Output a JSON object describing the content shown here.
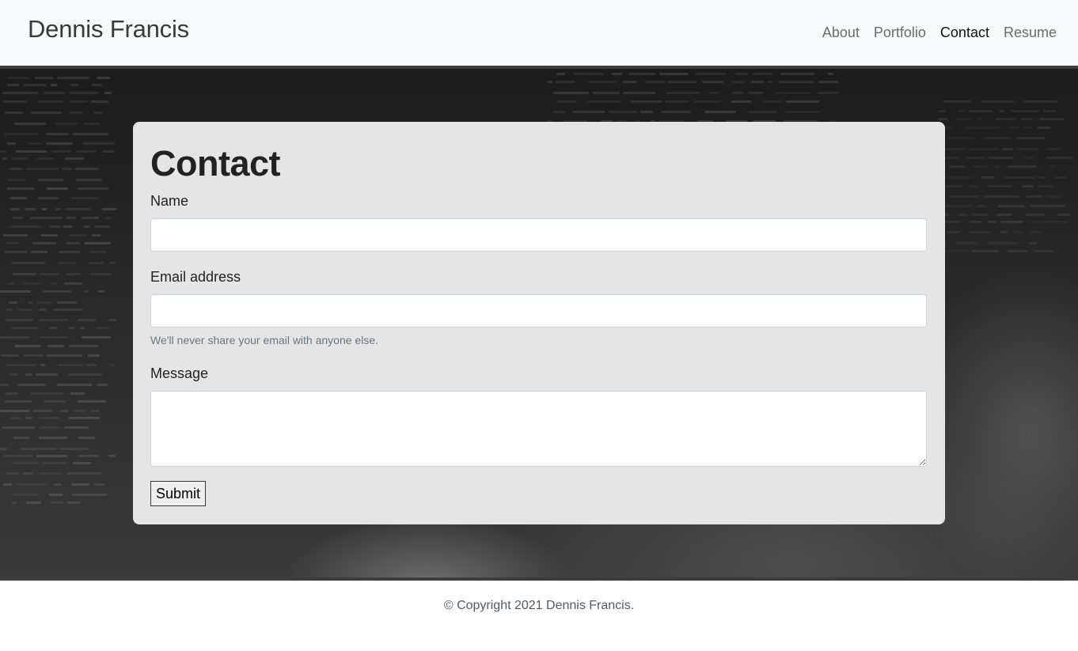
{
  "navbar": {
    "brand": "Dennis Francis",
    "links": [
      {
        "label": "About",
        "active": false
      },
      {
        "label": "Portfolio",
        "active": false
      },
      {
        "label": "Contact",
        "active": true
      },
      {
        "label": "Resume",
        "active": false
      }
    ]
  },
  "contact": {
    "title": "Contact",
    "name_label": "Name",
    "name_value": "",
    "email_label": "Email address",
    "email_value": "",
    "email_help": "We'll never share your email with anyone else.",
    "message_label": "Message",
    "message_value": "",
    "submit_label": "Submit"
  },
  "footer": {
    "text": "© Copyright 2021 Dennis Francis."
  },
  "colors": {
    "navbar_bg": "#f8f9fa",
    "card_bg": "#e5e5e5",
    "active_link": "#111111",
    "inactive_link": "#6c6c6c"
  }
}
